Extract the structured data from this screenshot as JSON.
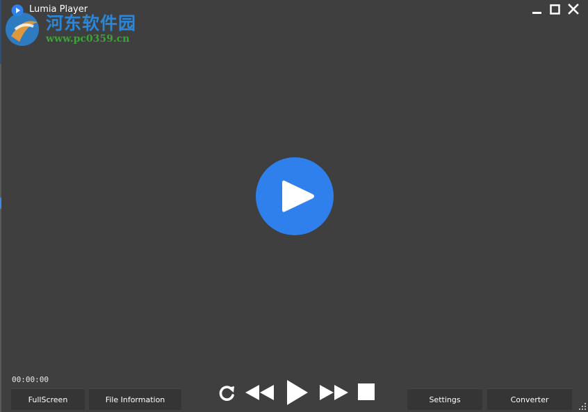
{
  "window": {
    "title": "Lumia Player",
    "controls": [
      "minimize-icon",
      "maximize-icon",
      "close-icon"
    ]
  },
  "watermark": {
    "site_name": "河东软件园",
    "url": "www.pc0359.cn"
  },
  "player": {
    "time": "00:00:00",
    "center_control": "play-icon"
  },
  "buttons": {
    "fullscreen": "FullScreen",
    "file_information": "File Information",
    "settings": "Settings",
    "converter": "Converter"
  },
  "transport": [
    "repeat-icon",
    "rewind-icon",
    "play-icon",
    "fast-forward-icon",
    "stop-icon"
  ],
  "colors": {
    "background": "#3f3f3f",
    "button": "#353535",
    "accent": "#2f80ed",
    "text": "#ffffff"
  }
}
